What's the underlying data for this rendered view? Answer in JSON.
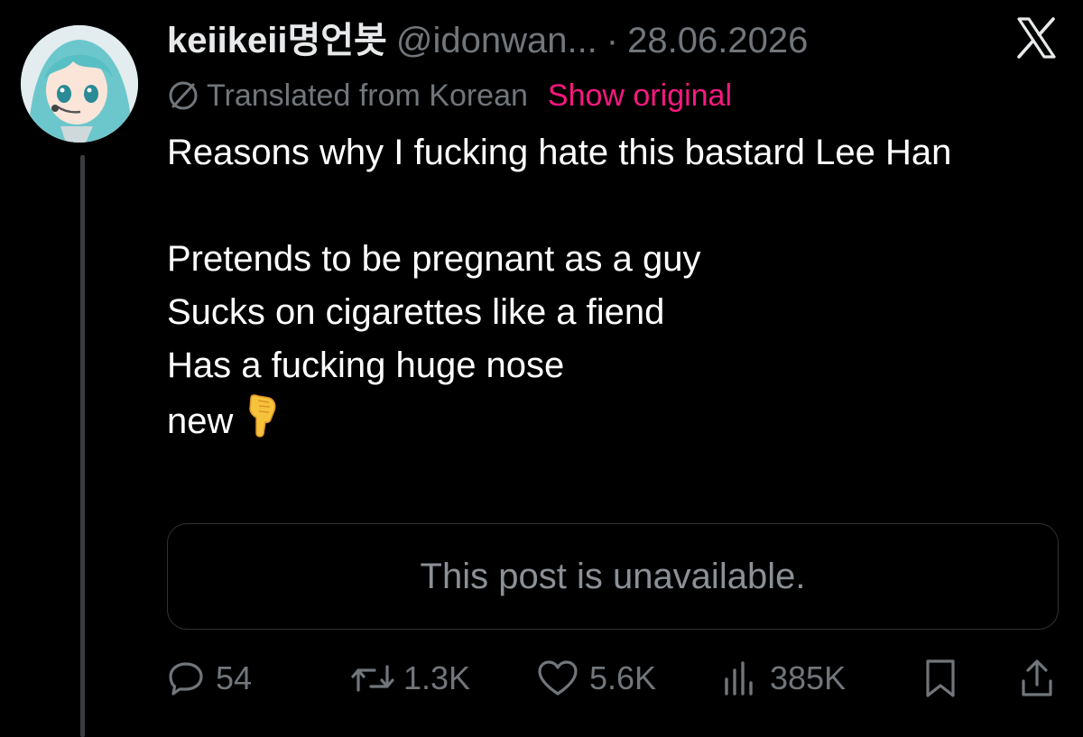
{
  "tweet": {
    "display_name": "keiikeii명언봇",
    "handle": "@idonwan...",
    "separator": "·",
    "date": "28.06.2026",
    "translation": {
      "label": "Translated from Korean",
      "show_original": "Show original"
    },
    "body_lines": [
      "Reasons why I fucking hate this bastard Lee Han",
      "Pretends to be pregnant as a guy",
      "Sucks on cigarettes like a fiend",
      "Has a fucking huge nose",
      "new"
    ],
    "quoted_post": "This post is unavailable.",
    "stats": {
      "replies": "54",
      "reposts": "1.3K",
      "likes": "5.6K",
      "views": "385K"
    }
  },
  "icons": {
    "brand": "x-logo-icon",
    "translate": "globe-icon",
    "emoji": "backhand-index-pointing-down",
    "reply": "reply-icon",
    "repost": "repost-icon",
    "like": "heart-icon",
    "views": "views-icon",
    "bookmark": "bookmark-icon",
    "share": "share-icon"
  },
  "colors": {
    "background": "#000000",
    "text": "#e7e9ea",
    "muted": "#71767b",
    "accent": "#f91880",
    "border": "#2f3336"
  }
}
